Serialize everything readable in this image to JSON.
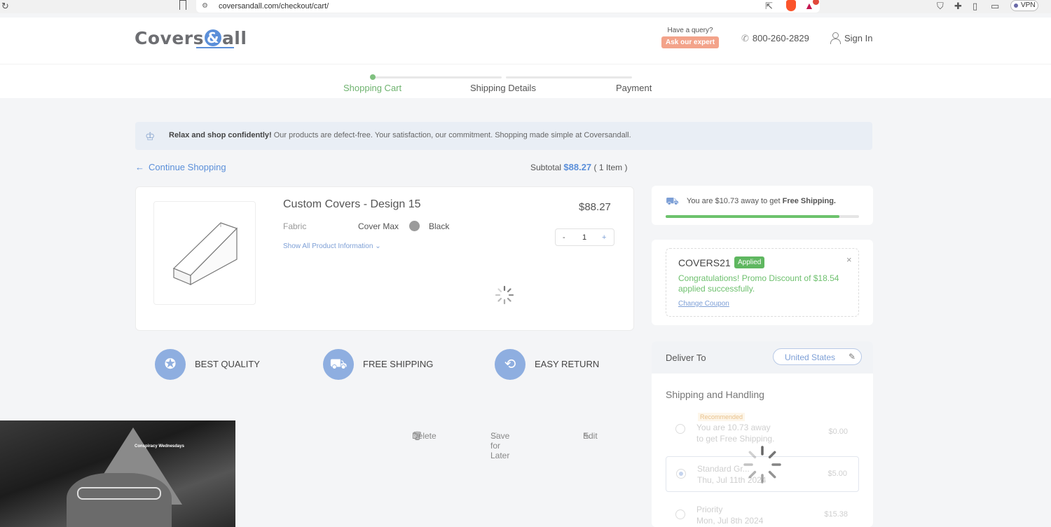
{
  "browser": {
    "url": "coversandall.com/checkout/cart/",
    "vpn_label": "VPN",
    "rewards_badge": "1"
  },
  "header": {
    "logo_part1": "Covers",
    "logo_amp": "&",
    "logo_part2": "all",
    "query_label": "Have a query?",
    "expert_label": "Ask our expert",
    "phone": "800-260-2829",
    "signin": "Sign In"
  },
  "steps": [
    "Shopping Cart",
    "Shipping Details",
    "Payment"
  ],
  "banner": {
    "bold": "Relax and shop confidently!",
    "text": " Our products are defect-free. Your satisfaction, our commitment. Shopping made simple at Coversandall."
  },
  "cart": {
    "continue": "Continue Shopping",
    "subtotal_label": "Subtotal",
    "subtotal_amount": "$88.27",
    "item_count": "( 1 Item )"
  },
  "product": {
    "name": "Custom Covers - Design 15",
    "price": "$88.27",
    "fabric_label": "Fabric",
    "fabric_value": "Cover Max",
    "color_name": "Black",
    "color_hex": "#9b9b9b",
    "show_all": "Show All Product Information",
    "qty_minus": "-",
    "qty": "1",
    "qty_plus": "+",
    "delete": "Delete",
    "save_later": "Save for Later",
    "edit": "Edit"
  },
  "features": [
    "BEST QUALITY",
    "FREE SHIPPING",
    "EASY RETURN"
  ],
  "shipping_progress": {
    "text_pre": "You are $10.73 away to get ",
    "text_bold": "Free Shipping.",
    "progress": 0.9
  },
  "coupon": {
    "code": "COVERS21",
    "status": "Applied",
    "message": "Congratulations! Promo Discount of $18.54 applied successfully.",
    "change": "Change Coupon",
    "close": "×"
  },
  "delivery": {
    "label": "Deliver To",
    "country": "United States",
    "shipping_title": "Shipping and Handling",
    "options": [
      {
        "badge": "Recommended",
        "line1": "You are 10.73 away",
        "line2": "to get Free Shipping.",
        "price": "$0.00",
        "selected": false
      },
      {
        "badge": "",
        "line1": "Standard Gr...",
        "line2": "Thu, Jul 11th 2024",
        "price": "$5.00",
        "selected": true
      },
      {
        "badge": "",
        "line1": "Priority",
        "line2": "Mon, Jul 8th 2024",
        "price": "$15.38",
        "selected": false
      }
    ]
  },
  "video": {
    "caption": "Conspiracy Wednesdays"
  },
  "colors": {
    "accent": "#5b8fd9",
    "success": "#6cc26c",
    "expert_badge": "#f3a38a"
  }
}
